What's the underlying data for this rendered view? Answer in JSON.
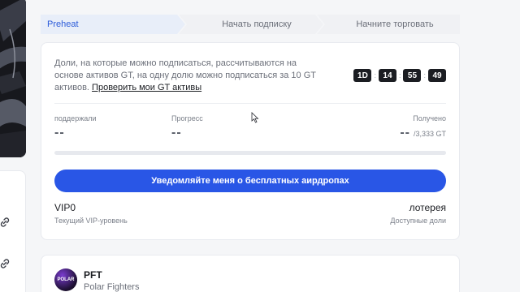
{
  "steps": [
    "Preheat",
    "Начать подписку",
    "Начните торговать"
  ],
  "description": {
    "text": "Доли, на которые можно подписаться, рассчитываются на основе активов GT, на одну долю можно подписаться за 10 GT активов.",
    "link": "Проверить мои GT активы"
  },
  "countdown": {
    "days": "1D",
    "hours": "14",
    "minutes": "55",
    "seconds": "49"
  },
  "stats": {
    "supported_label": "поддержали",
    "supported_value": "--",
    "progress_label": "Прогресс",
    "progress_value": "--",
    "received_label": "Получено",
    "received_value": "--",
    "received_total": "/3,333 GT"
  },
  "progress_fraction": 0,
  "cta_label": "Уведомляйте меня о бесплатных аирдропах",
  "vip": {
    "value": "VIP0",
    "label": "Текущий VIP-уровень"
  },
  "lottery": {
    "value": "лотерея",
    "label": "Доступные доли"
  },
  "project": {
    "symbol": "PFT",
    "name": "Polar Fighters",
    "avatar_text": "POLAR"
  },
  "colors": {
    "accent": "#2956e6",
    "dark": "#1b1d22"
  }
}
